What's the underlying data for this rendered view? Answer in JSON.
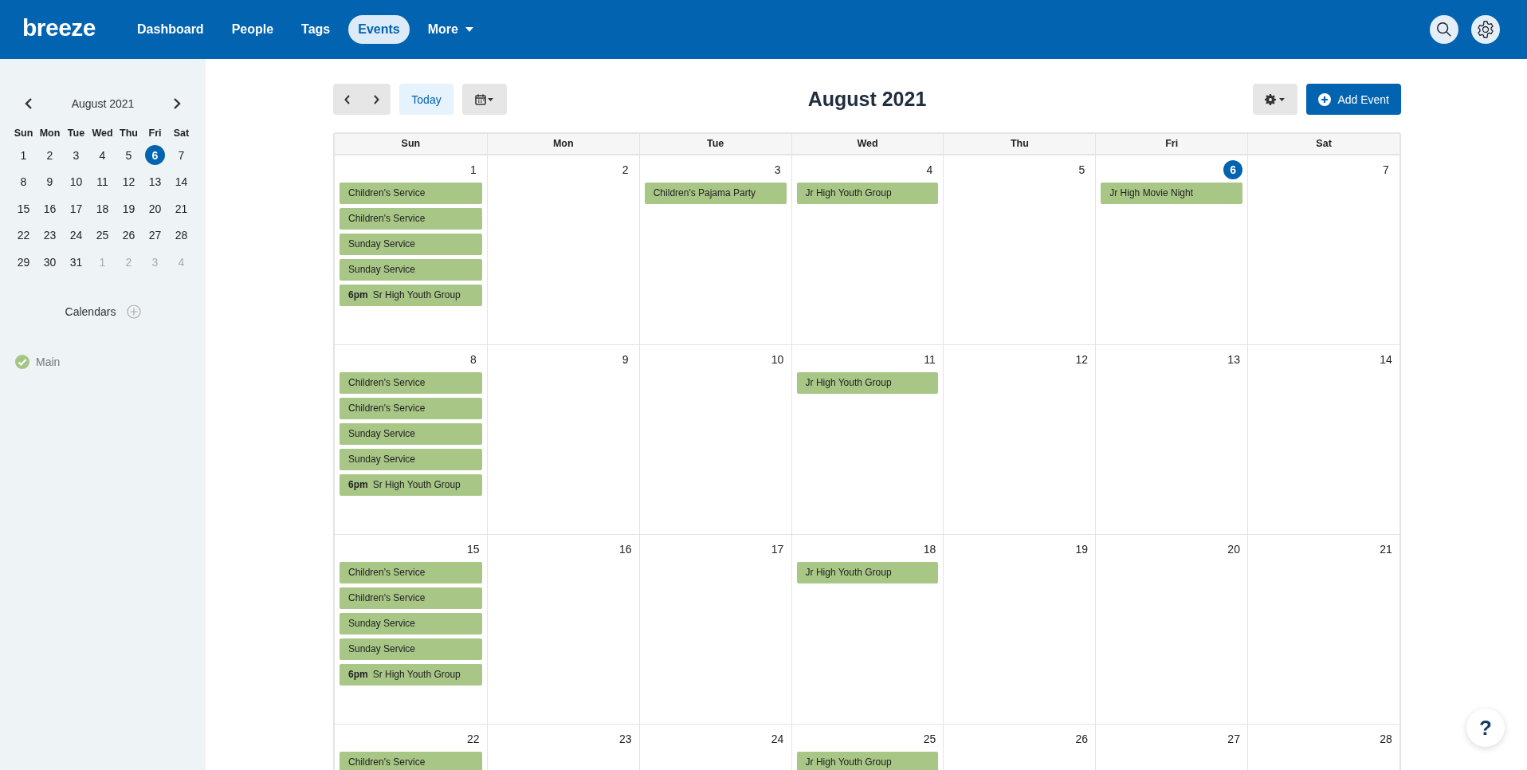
{
  "header": {
    "logo": "breeze",
    "nav": [
      {
        "label": "Dashboard",
        "selected": false,
        "has_menu": false
      },
      {
        "label": "People",
        "selected": false,
        "has_menu": false
      },
      {
        "label": "Tags",
        "selected": false,
        "has_menu": false
      },
      {
        "label": "Events",
        "selected": true,
        "has_menu": false
      },
      {
        "label": "More",
        "selected": false,
        "has_menu": true
      }
    ]
  },
  "sidebar": {
    "mini_calendar": {
      "month": "August 2021",
      "weekdays": [
        "Sun",
        "Mon",
        "Tue",
        "Wed",
        "Thu",
        "Fri",
        "Sat"
      ],
      "weeks": [
        [
          {
            "day": "1",
            "selected": false,
            "outside": false
          },
          {
            "day": "2",
            "selected": false,
            "outside": false
          },
          {
            "day": "3",
            "selected": false,
            "outside": false
          },
          {
            "day": "4",
            "selected": false,
            "outside": false
          },
          {
            "day": "5",
            "selected": false,
            "outside": false
          },
          {
            "day": "6",
            "selected": true,
            "outside": false
          },
          {
            "day": "7",
            "selected": false,
            "outside": false
          }
        ],
        [
          {
            "day": "8",
            "selected": false,
            "outside": false
          },
          {
            "day": "9",
            "selected": false,
            "outside": false
          },
          {
            "day": "10",
            "selected": false,
            "outside": false
          },
          {
            "day": "11",
            "selected": false,
            "outside": false
          },
          {
            "day": "12",
            "selected": false,
            "outside": false
          },
          {
            "day": "13",
            "selected": false,
            "outside": false
          },
          {
            "day": "14",
            "selected": false,
            "outside": false
          }
        ],
        [
          {
            "day": "15",
            "selected": false,
            "outside": false
          },
          {
            "day": "16",
            "selected": false,
            "outside": false
          },
          {
            "day": "17",
            "selected": false,
            "outside": false
          },
          {
            "day": "18",
            "selected": false,
            "outside": false
          },
          {
            "day": "19",
            "selected": false,
            "outside": false
          },
          {
            "day": "20",
            "selected": false,
            "outside": false
          },
          {
            "day": "21",
            "selected": false,
            "outside": false
          }
        ],
        [
          {
            "day": "22",
            "selected": false,
            "outside": false
          },
          {
            "day": "23",
            "selected": false,
            "outside": false
          },
          {
            "day": "24",
            "selected": false,
            "outside": false
          },
          {
            "day": "25",
            "selected": false,
            "outside": false
          },
          {
            "day": "26",
            "selected": false,
            "outside": false
          },
          {
            "day": "27",
            "selected": false,
            "outside": false
          },
          {
            "day": "28",
            "selected": false,
            "outside": false
          }
        ],
        [
          {
            "day": "29",
            "selected": false,
            "outside": false
          },
          {
            "day": "30",
            "selected": false,
            "outside": false
          },
          {
            "day": "31",
            "selected": false,
            "outside": false
          },
          {
            "day": "1",
            "selected": false,
            "outside": true
          },
          {
            "day": "2",
            "selected": false,
            "outside": true
          },
          {
            "day": "3",
            "selected": false,
            "outside": true
          },
          {
            "day": "4",
            "selected": false,
            "outside": true
          }
        ]
      ]
    },
    "calendars_label": "Calendars",
    "calendars": [
      {
        "name": "Main",
        "checked": true,
        "color": "#a3c585"
      }
    ]
  },
  "toolbar": {
    "today": "Today",
    "title": "August 2021",
    "add_event": "Add Event"
  },
  "calendar": {
    "weekdays": [
      "Sun",
      "Mon",
      "Tue",
      "Wed",
      "Thu",
      "Fri",
      "Sat"
    ],
    "weeks": [
      {
        "days": [
          {
            "day": "1",
            "today": false,
            "events": [
              {
                "title": "Children's Service"
              },
              {
                "title": "Children's Service"
              },
              {
                "title": "Sunday Service"
              },
              {
                "title": "Sunday Service"
              },
              {
                "time": "6pm",
                "title": "Sr High Youth Group"
              }
            ]
          },
          {
            "day": "2",
            "today": false
          },
          {
            "day": "3",
            "today": false,
            "events": [
              {
                "title": "Children's Pajama Party"
              }
            ]
          },
          {
            "day": "4",
            "today": false,
            "events": [
              {
                "title": "Jr High Youth Group"
              }
            ]
          },
          {
            "day": "5",
            "today": false
          },
          {
            "day": "6",
            "today": true,
            "events": [
              {
                "title": "Jr High Movie Night"
              }
            ]
          },
          {
            "day": "7",
            "today": false
          }
        ]
      },
      {
        "days": [
          {
            "day": "8",
            "today": false,
            "events": [
              {
                "title": "Children's Service"
              },
              {
                "title": "Children's Service"
              },
              {
                "title": "Sunday Service"
              },
              {
                "title": "Sunday Service"
              },
              {
                "time": "6pm",
                "title": "Sr High Youth Group"
              }
            ]
          },
          {
            "day": "9",
            "today": false
          },
          {
            "day": "10",
            "today": false
          },
          {
            "day": "11",
            "today": false,
            "events": [
              {
                "title": "Jr High Youth Group"
              }
            ]
          },
          {
            "day": "12",
            "today": false
          },
          {
            "day": "13",
            "today": false
          },
          {
            "day": "14",
            "today": false
          }
        ]
      },
      {
        "days": [
          {
            "day": "15",
            "today": false,
            "events": [
              {
                "title": "Children's Service"
              },
              {
                "title": "Children's Service"
              },
              {
                "title": "Sunday Service"
              },
              {
                "title": "Sunday Service"
              },
              {
                "time": "6pm",
                "title": "Sr High Youth Group"
              }
            ]
          },
          {
            "day": "16",
            "today": false
          },
          {
            "day": "17",
            "today": false
          },
          {
            "day": "18",
            "today": false,
            "events": [
              {
                "title": "Jr High Youth Group"
              }
            ]
          },
          {
            "day": "19",
            "today": false
          },
          {
            "day": "20",
            "today": false
          },
          {
            "day": "21",
            "today": false
          }
        ]
      },
      {
        "days": [
          {
            "day": "22",
            "today": false,
            "events": [
              {
                "title": "Children's Service"
              }
            ]
          },
          {
            "day": "23",
            "today": false
          },
          {
            "day": "24",
            "today": false
          },
          {
            "day": "25",
            "today": false,
            "events": [
              {
                "title": "Jr High Youth Group"
              }
            ]
          },
          {
            "day": "26",
            "today": false
          },
          {
            "day": "27",
            "today": false
          },
          {
            "day": "28",
            "today": false
          }
        ]
      }
    ]
  },
  "help": {
    "label": "?"
  }
}
